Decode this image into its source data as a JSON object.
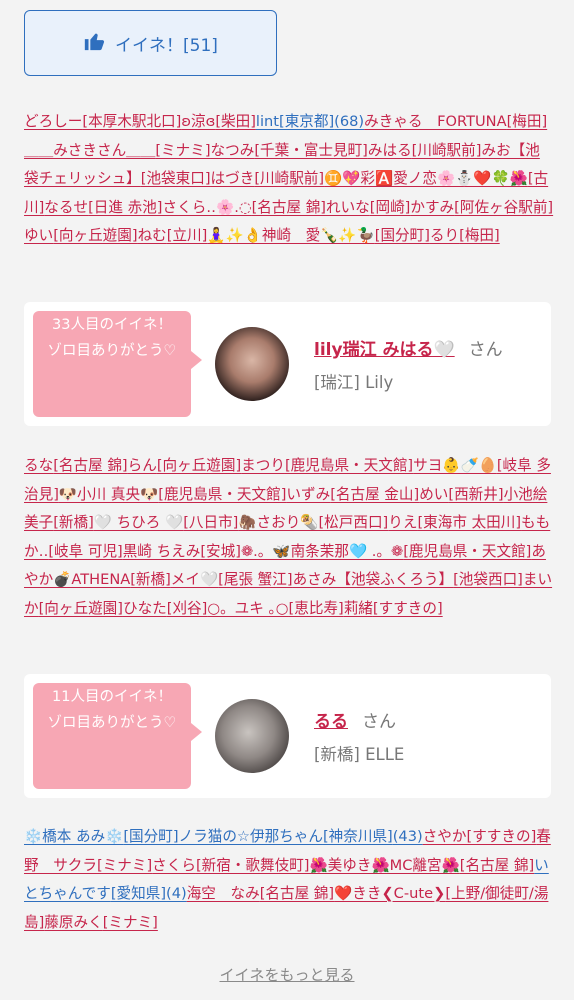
{
  "like_button": {
    "label": "イイネ！[51]",
    "icon": "thumbs-up-icon"
  },
  "block1": [
    {
      "t": "どろしー",
      "c": "pink"
    },
    {
      "t": "[本厚木駅北口]",
      "c": "pink"
    },
    {
      "t": "ʚ涼ɞ",
      "c": "pink"
    },
    {
      "t": "[柴田]",
      "c": "pink"
    },
    {
      "t": "lint",
      "c": "blue"
    },
    {
      "t": "[東京都]",
      "c": "blue"
    },
    {
      "t": "(68)",
      "c": "blue"
    },
    {
      "t": "みきゃる　FORTUNA",
      "c": "pink"
    },
    {
      "t": "[梅田]",
      "c": "pink"
    },
    {
      "t": "＿＿みさきさん＿＿",
      "c": "pink"
    },
    {
      "t": "[ミナミ]",
      "c": "pink"
    },
    {
      "t": "なつみ",
      "c": "pink"
    },
    {
      "t": "[千葉・富士見町]",
      "c": "pink"
    },
    {
      "t": "みはる",
      "c": "pink"
    },
    {
      "t": "[川崎駅前]",
      "c": "pink"
    },
    {
      "t": "みお【池袋チェリッシュ】",
      "c": "pink"
    },
    {
      "t": "[池袋東口]",
      "c": "pink"
    },
    {
      "t": "はづき",
      "c": "pink"
    },
    {
      "t": "[川崎駅前]",
      "c": "pink"
    },
    {
      "t": "♊️💖彩🅰️愛ノ恋🌸⛄️❤️🍀🌺",
      "c": "pink"
    },
    {
      "t": "[古川]",
      "c": "pink"
    },
    {
      "t": "なるせ",
      "c": "pink"
    },
    {
      "t": "[日進 赤池]",
      "c": "pink"
    },
    {
      "t": "さくら‥🌸.◌",
      "c": "pink"
    },
    {
      "t": "[名古屋 錦]",
      "c": "pink"
    },
    {
      "t": "れいな",
      "c": "pink"
    },
    {
      "t": "[岡崎]",
      "c": "pink"
    },
    {
      "t": "かすみ",
      "c": "pink"
    },
    {
      "t": "[阿佐ヶ谷駅前]",
      "c": "pink"
    },
    {
      "t": "ゆい",
      "c": "pink"
    },
    {
      "t": "[向ヶ丘遊園]",
      "c": "pink"
    },
    {
      "t": "ねむ",
      "c": "pink"
    },
    {
      "t": "[立川]",
      "c": "pink"
    },
    {
      "t": "🧘‍♀️✨👌神崎　愛🍾✨🦆",
      "c": "pink"
    },
    {
      "t": "[国分町]",
      "c": "pink"
    },
    {
      "t": "るり",
      "c": "pink"
    },
    {
      "t": "[梅田]",
      "c": "pink"
    }
  ],
  "card1": {
    "bubble": "33人目のイイネ！\nゾロ目ありがとう♡",
    "name": "lily瑞江 みはる🤍",
    "san": "さん",
    "shop": "[瑞江] Lily"
  },
  "block2": [
    {
      "t": "るな",
      "c": "pink"
    },
    {
      "t": "[名古屋 錦]",
      "c": "pink"
    },
    {
      "t": "らん",
      "c": "pink"
    },
    {
      "t": "[向ヶ丘遊園]",
      "c": "pink"
    },
    {
      "t": "まつり",
      "c": "pink"
    },
    {
      "t": "[鹿児島県・天文館]",
      "c": "pink"
    },
    {
      "t": "サヨ👶🍼🥚",
      "c": "pink"
    },
    {
      "t": "[岐阜 多治見]",
      "c": "pink"
    },
    {
      "t": "🐶小川 真央🐶",
      "c": "pink"
    },
    {
      "t": "[鹿児島県・天文館]",
      "c": "pink"
    },
    {
      "t": "いずみ",
      "c": "pink"
    },
    {
      "t": "[名古屋 金山]",
      "c": "pink"
    },
    {
      "t": "めい",
      "c": "pink"
    },
    {
      "t": "[西新井]",
      "c": "pink"
    },
    {
      "t": "小池絵美子",
      "c": "pink"
    },
    {
      "t": "[新橋]",
      "c": "pink"
    },
    {
      "t": "🤍 ちひろ 🤍",
      "c": "pink"
    },
    {
      "t": "[八日市]",
      "c": "pink"
    },
    {
      "t": "🦣さおり🌯",
      "c": "pink"
    },
    {
      "t": "[松戸西口]",
      "c": "pink"
    },
    {
      "t": "りえ",
      "c": "pink"
    },
    {
      "t": "[東海市 太田川]",
      "c": "pink"
    },
    {
      "t": "ももか‥",
      "c": "pink"
    },
    {
      "t": "[岐阜 可児]",
      "c": "pink"
    },
    {
      "t": "黒崎 ちえみ",
      "c": "pink"
    },
    {
      "t": "[安城]",
      "c": "pink"
    },
    {
      "t": "❁.。🦋南条茉那🩵 .。❁",
      "c": "pink"
    },
    {
      "t": "[鹿児島県・天文館]",
      "c": "pink"
    },
    {
      "t": "あやか💣ATHENA",
      "c": "pink"
    },
    {
      "t": "[新橋]",
      "c": "pink"
    },
    {
      "t": "メイ🤍",
      "c": "pink"
    },
    {
      "t": "[尾張 蟹江]",
      "c": "pink"
    },
    {
      "t": "あさみ【池袋ふくろう】",
      "c": "pink"
    },
    {
      "t": "[池袋西口]",
      "c": "pink"
    },
    {
      "t": "まいか",
      "c": "pink"
    },
    {
      "t": "[向ヶ丘遊園]",
      "c": "pink"
    },
    {
      "t": "ひなた",
      "c": "pink"
    },
    {
      "t": "[刈谷]",
      "c": "pink"
    },
    {
      "t": "○。ユキ ｡○",
      "c": "pink"
    },
    {
      "t": "[恵比寿]",
      "c": "pink"
    },
    {
      "t": "莉緒",
      "c": "pink"
    },
    {
      "t": "[すすきの]",
      "c": "pink"
    }
  ],
  "card2": {
    "bubble": "11人目のイイネ！\nゾロ目ありがとう♡",
    "name": "るる",
    "san": "さん",
    "shop": "[新橋] ELLE"
  },
  "block3": [
    {
      "t": "❄️橋本 あみ❄️",
      "c": "blue"
    },
    {
      "t": "[国分町]",
      "c": "blue"
    },
    {
      "t": "ノラ猫の☆伊那ちゃん",
      "c": "blue"
    },
    {
      "t": "[神奈川県]",
      "c": "blue"
    },
    {
      "t": "(43)",
      "c": "blue"
    },
    {
      "t": "さやか",
      "c": "pink"
    },
    {
      "t": "[すすきの]",
      "c": "pink"
    },
    {
      "t": "春野　サクラ",
      "c": "pink"
    },
    {
      "t": "[ミナミ]",
      "c": "pink"
    },
    {
      "t": "さくら",
      "c": "pink"
    },
    {
      "t": "[新宿・歌舞伎町]",
      "c": "pink"
    },
    {
      "t": "🌺美ゆき🌺MC離宮🌺",
      "c": "pink"
    },
    {
      "t": "[名古屋 錦]",
      "c": "pink"
    },
    {
      "t": "いとちゃんです",
      "c": "blue"
    },
    {
      "t": "[愛知県]",
      "c": "blue"
    },
    {
      "t": "(4)",
      "c": "blue"
    },
    {
      "t": "海空　なみ",
      "c": "pink"
    },
    {
      "t": "[名古屋 錦]",
      "c": "pink"
    },
    {
      "t": "❤️きき❮C-ute❯",
      "c": "pink"
    },
    {
      "t": "[上野/御徒町/湯島]",
      "c": "pink"
    },
    {
      "t": "藤原みく",
      "c": "pink"
    },
    {
      "t": "[ミナミ]",
      "c": "pink"
    }
  ],
  "more_link": "イイネをもっと見る"
}
